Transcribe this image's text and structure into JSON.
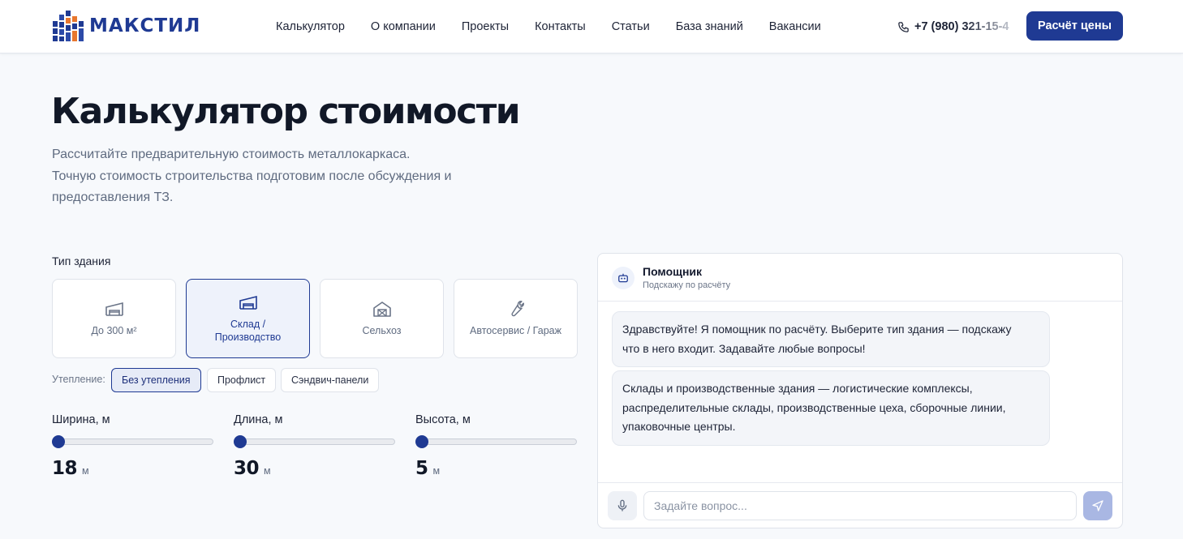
{
  "header": {
    "logo_text": "МАКСТИЛ",
    "nav": [
      "Калькулятор",
      "О компании",
      "Проекты",
      "Контакты",
      "Статьи",
      "База знаний",
      "Вакансии"
    ],
    "phone": "+7 (980) 321-15-4",
    "cta_label": "Расчёт цены"
  },
  "hero": {
    "title": "Калькулятор стоимости",
    "subtitle_lines": [
      "Рассчитайте предварительную стоимость металлокаркаса.",
      "Точную стоимость строительства подготовим после обсуждения и",
      "предоставления ТЗ."
    ]
  },
  "calculator": {
    "building_type_label": "Тип здания",
    "building_types": [
      {
        "lines": [
          "До 300 м²"
        ],
        "icon": "small-building-icon",
        "selected": false
      },
      {
        "lines": [
          "Склад /",
          "Производство"
        ],
        "icon": "warehouse-icon",
        "selected": true
      },
      {
        "lines": [
          "Сельхоз"
        ],
        "icon": "barn-icon",
        "selected": false
      },
      {
        "lines": [
          "Автосервис / Гараж"
        ],
        "icon": "wrench-icon",
        "selected": false
      }
    ],
    "insulation_label": "Утепление:",
    "insulation_options": [
      {
        "label": "Без утепления",
        "selected": true
      },
      {
        "label": "Профлист",
        "selected": false
      },
      {
        "label": "Сэндвич-панели",
        "selected": false
      }
    ],
    "dimensions": [
      {
        "label": "Ширина, м",
        "value": "18",
        "unit": "м",
        "slider_fraction": 0.0
      },
      {
        "label": "Длина, м",
        "value": "30",
        "unit": "м",
        "slider_fraction": 0.0
      },
      {
        "label": "Высота, м",
        "value": "5",
        "unit": "м",
        "slider_fraction": 0.0
      }
    ]
  },
  "assistant": {
    "name": "Помощник",
    "subtitle": "Подскажу по расчёту",
    "messages": [
      {
        "lines": [
          "Здравствуйте! Я помощник по расчёту. Выберите тип здания — подскажу",
          "что в него входит. Задавайте любые вопросы!"
        ]
      },
      {
        "lines": [
          "Склады и производственные здания — логистические комплексы,",
          "распределительные склады, производственные цеха, сборочные линии,",
          "упаковочные центры."
        ]
      }
    ],
    "input_placeholder": "Задайте вопрос..."
  },
  "colors": {
    "accent": "#1f3a93",
    "logo_orange": "#e8772e",
    "send_disabled": "#a9b7e3"
  }
}
